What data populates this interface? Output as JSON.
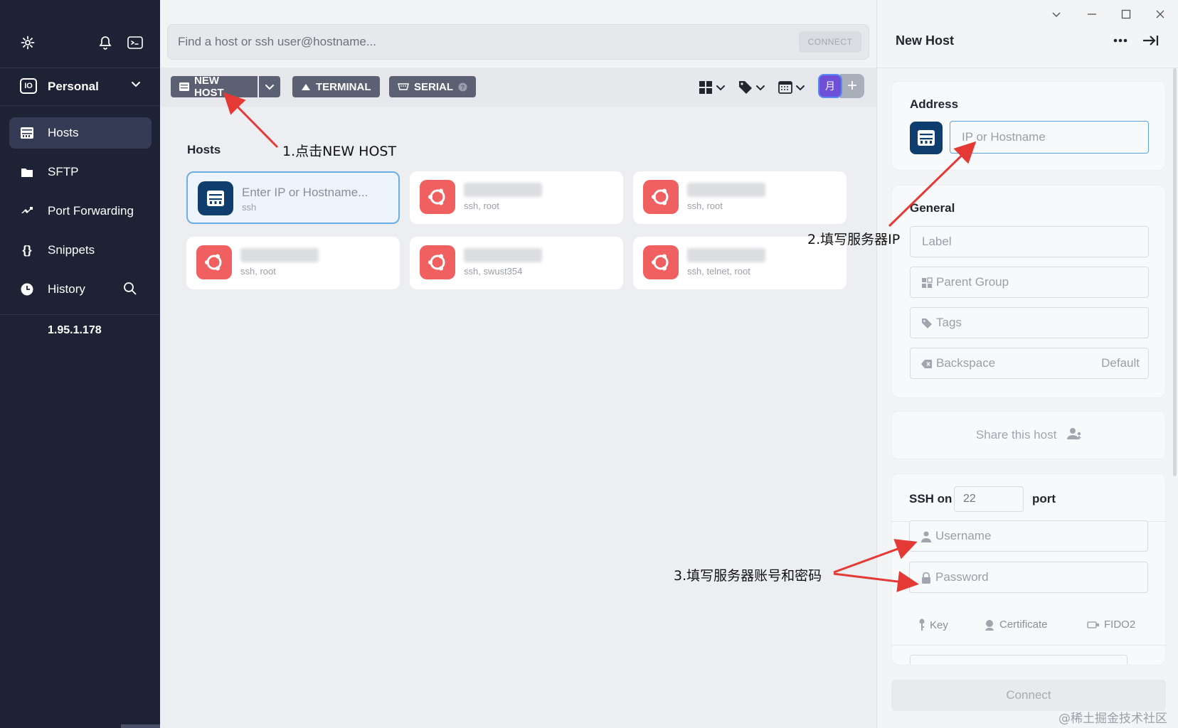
{
  "sidebar": {
    "vault_logo": "IO",
    "vault_name": "Personal",
    "nav": [
      {
        "label": "Hosts",
        "icon": "hosts-icon"
      },
      {
        "label": "SFTP",
        "icon": "folder-icon"
      },
      {
        "label": "Port Forwarding",
        "icon": "port-forward-icon"
      },
      {
        "label": "Snippets",
        "icon": "braces-icon"
      },
      {
        "label": "History",
        "icon": "clock-icon"
      }
    ],
    "recent_ip": "1.95.1.178"
  },
  "search": {
    "placeholder": "Find a host or ssh user@hostname...",
    "connect_label": "CONNECT"
  },
  "toolbar": {
    "new_host_label": "NEW HOST",
    "terminal_label": "TERMINAL",
    "serial_label": "SERIAL",
    "avatar_text": "月",
    "plus_label": "+"
  },
  "hosts": {
    "section_title": "Hosts",
    "cards": [
      {
        "title": "Enter IP or Hostname...",
        "subtitle": "ssh",
        "type": "server",
        "selected": true
      },
      {
        "title": "",
        "subtitle": "ssh, root",
        "type": "ubuntu"
      },
      {
        "title": "",
        "subtitle": "ssh, root",
        "type": "ubuntu"
      },
      {
        "title": "",
        "subtitle": "ssh, root",
        "type": "ubuntu"
      },
      {
        "title": "",
        "subtitle": "ssh, swust354",
        "type": "ubuntu"
      },
      {
        "title": "",
        "subtitle": "ssh, telnet, root",
        "type": "ubuntu"
      }
    ]
  },
  "panel": {
    "title": "New Host",
    "address": {
      "label": "Address",
      "placeholder": "IP or Hostname"
    },
    "general": {
      "label": "General",
      "label_field": "Label",
      "parent_group": "Parent Group",
      "tags": "Tags",
      "backspace": "Backspace",
      "backspace_value": "Default"
    },
    "share_label": "Share this host",
    "ssh": {
      "prefix": "SSH on",
      "port_placeholder": "22",
      "suffix": "port",
      "username": "Username",
      "password": "Password",
      "key": "Key",
      "certificate": "Certificate",
      "fido2": "FIDO2"
    },
    "connect_label": "Connect"
  },
  "annotations": {
    "step1": "1.点击NEW HOST",
    "step2": "2.填写服务器IP",
    "step3": "3.填写服务器账号和密码"
  },
  "watermark": "@稀土掘金技术社区",
  "colors": {
    "sidebar_bg": "#1d2235",
    "server_icon": "#0f3e6e",
    "ubuntu_icon": "#f06060",
    "focus_border": "#57a5e3",
    "arrow": "#e53935"
  }
}
